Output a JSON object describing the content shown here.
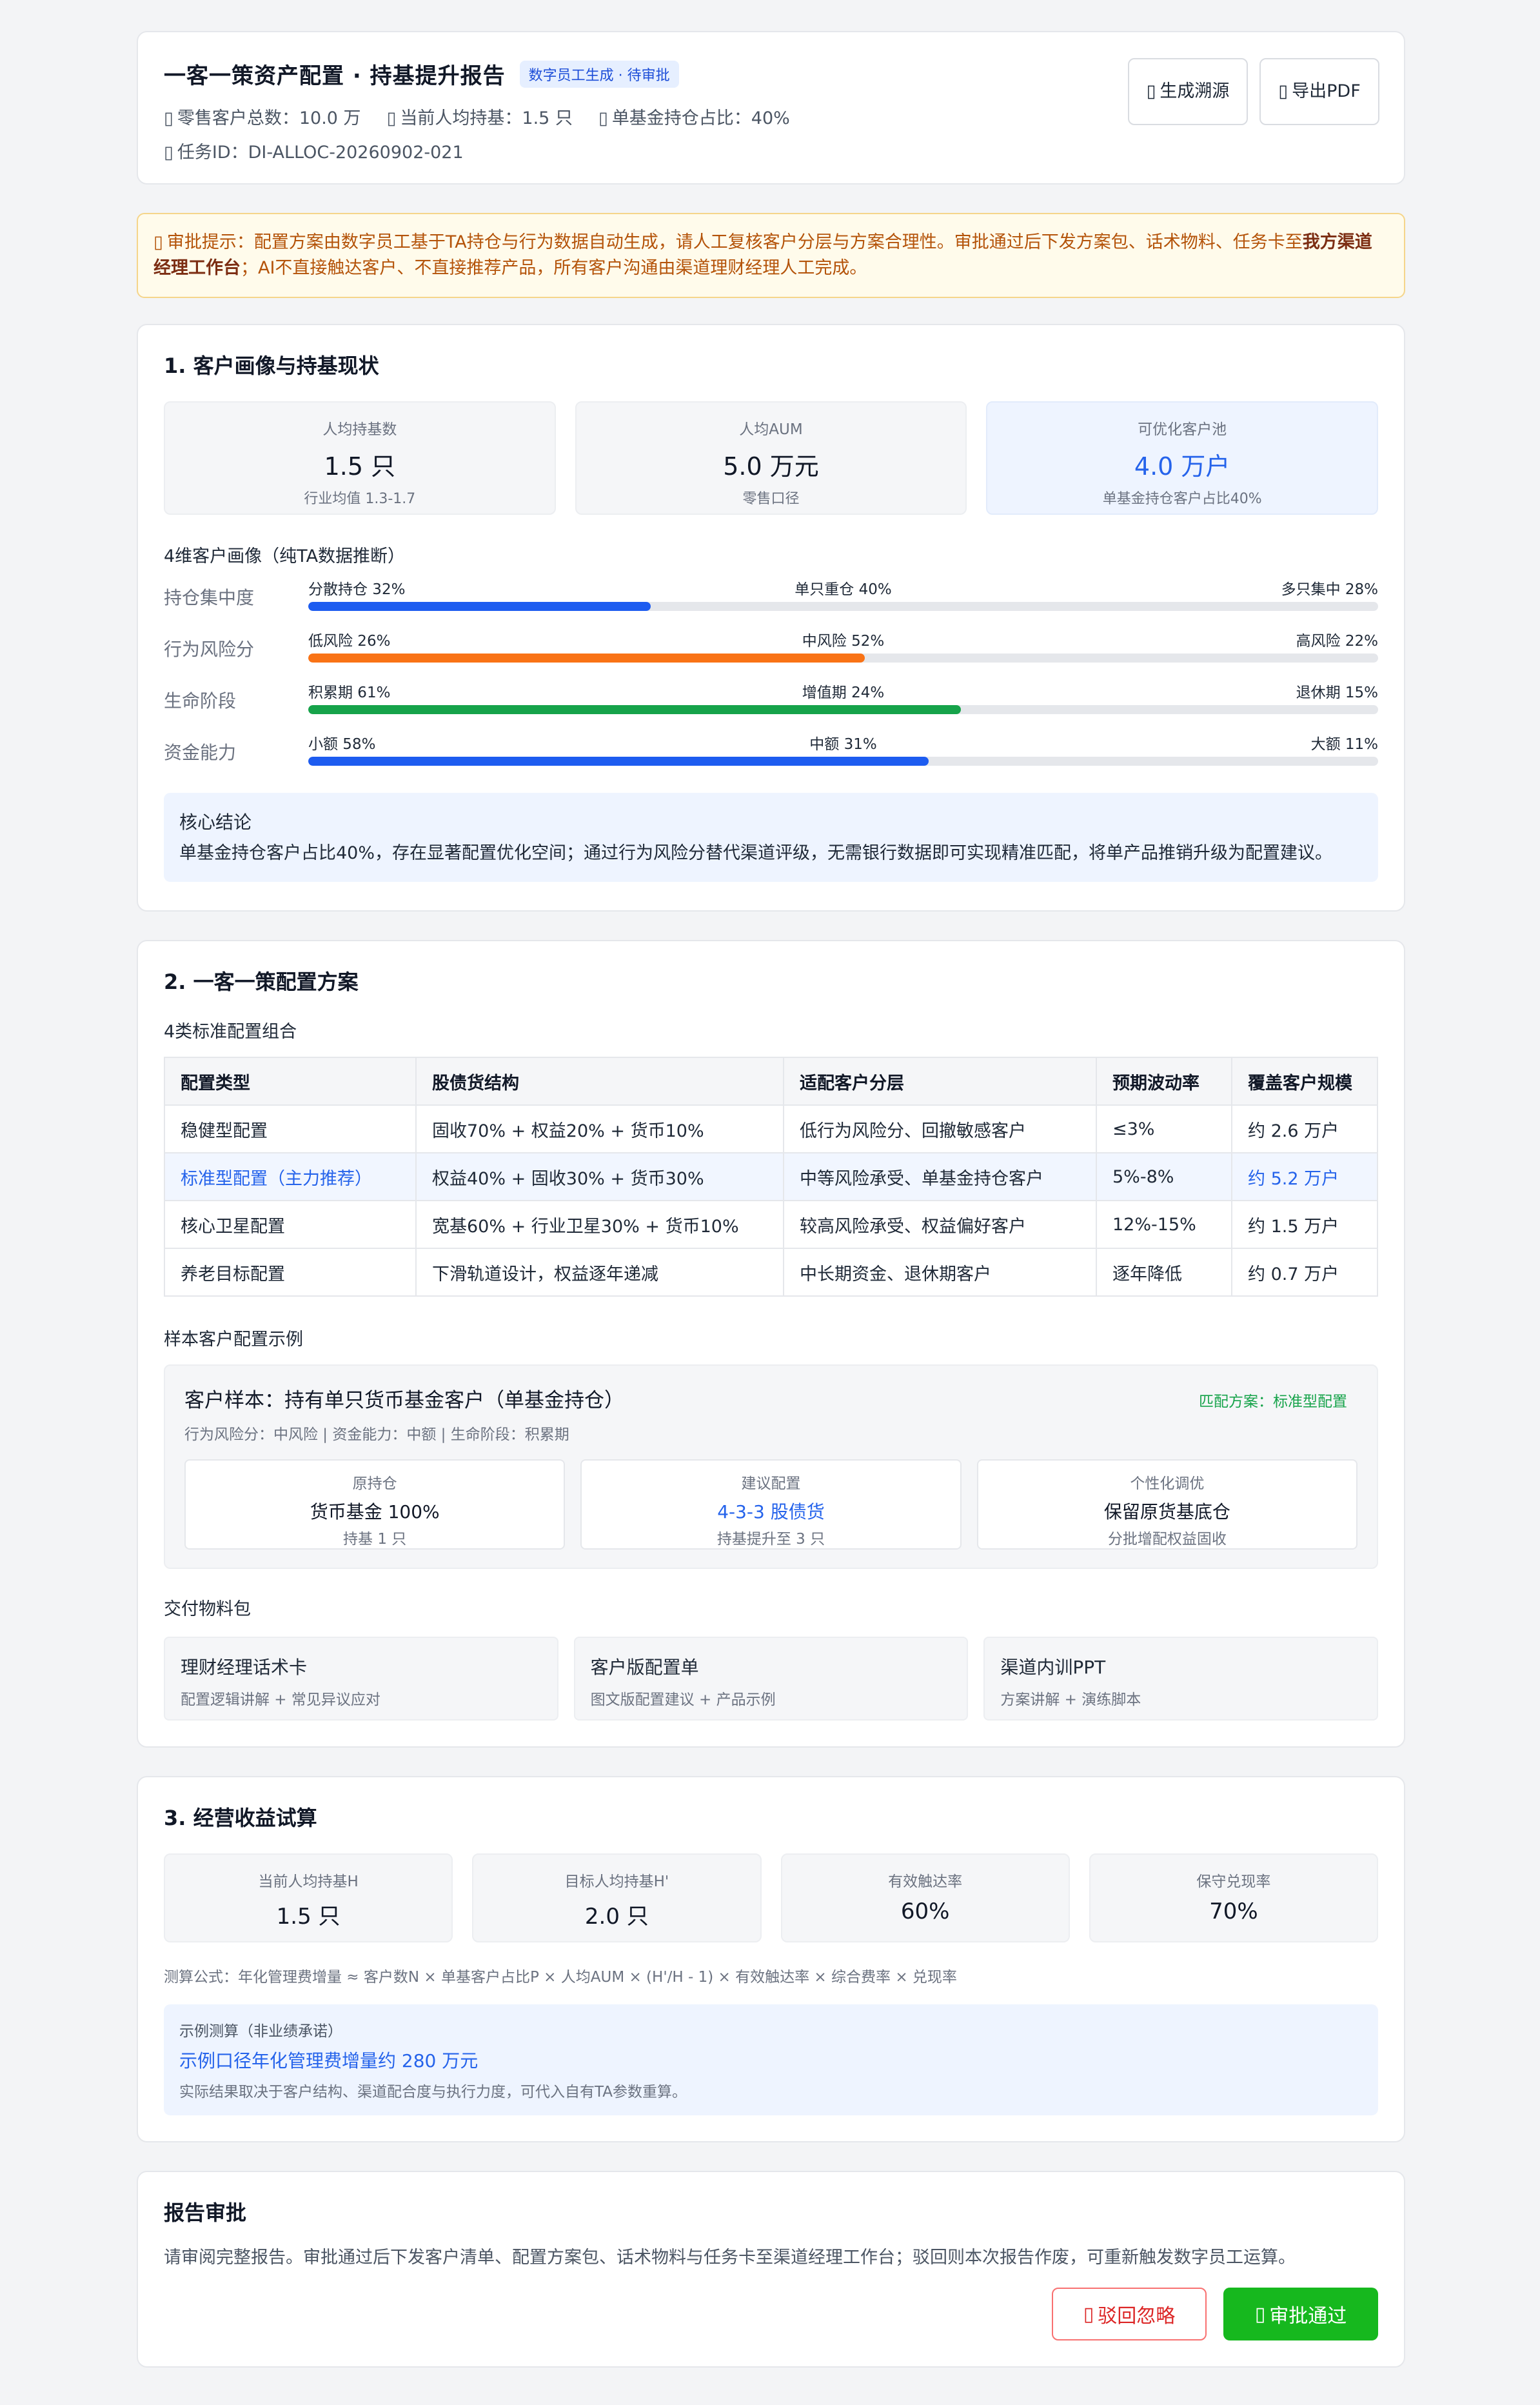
{
  "header": {
    "title": "一客一策资产配置 · 持基提升报告",
    "tag": "数字员工生成 · 待审批",
    "meta": [
      {
        "icon": "users-icon",
        "text": "零售客户总数：10.0 万"
      },
      {
        "icon": "chart-icon",
        "text": "当前人均持基：1.5 只"
      },
      {
        "icon": "pie-icon",
        "text": "单基金持仓占比：40%"
      }
    ],
    "task_id": "任务ID：DI-ALLOC-20260902-021",
    "trace_button": "生成溯源",
    "export_button": "导出PDF"
  },
  "notice": {
    "text_before": "审批提示：配置方案由数字员工基于TA持仓与行为数据自动生成，请人工复核客户分层与方案合理性。审批通过后下发方案包、话术物料、任务卡至",
    "bold": "我方渠道经理工作台",
    "text_after": "；AI不直接触达客户、不直接推荐产品，所有客户沟通由渠道理财经理人工完成。"
  },
  "section1": {
    "title": "1. 客户画像与持基现状",
    "stats": [
      {
        "label": "人均持基数",
        "value": "1.5 只",
        "note": "行业均值 1.3-1.7"
      },
      {
        "label": "人均AUM",
        "value": "5.0 万元",
        "note": "零售口径"
      },
      {
        "label": "可优化客户池",
        "value": "4.0 万户",
        "note": "单基金持仓客户占比40%"
      }
    ],
    "profile_title": "4维客户画像（纯TA数据推断）",
    "profiles": [
      {
        "label": "持仓集中度",
        "left": "分散持仓 32%",
        "mid": "单只重仓 40%",
        "right": "多只集中 28%",
        "fill": 32,
        "color": "#1d5cf0"
      },
      {
        "label": "行为风险分",
        "left": "低风险 26%",
        "mid": "中风险 52%",
        "right": "高风险 22%",
        "fill": 52,
        "color": "#f97316"
      },
      {
        "label": "生命阶段",
        "left": "积累期 61%",
        "mid": "增值期 24%",
        "right": "退休期 15%",
        "fill": 61,
        "color": "#16a34a"
      },
      {
        "label": "资金能力",
        "left": "小额 58%",
        "mid": "中额 31%",
        "right": "大额 11%",
        "fill": 58,
        "color": "#1d5cf0"
      }
    ],
    "conclusion_title": "核心结论",
    "conclusion_body": "单基金持仓客户占比40%，存在显著配置优化空间；通过行为风险分替代渠道评级，无需银行数据即可实现精准匹配，将单产品推销升级为配置建议。"
  },
  "section2": {
    "title": "2. 一客一策配置方案",
    "table_title": "4类标准配置组合",
    "columns": [
      "配置类型",
      "股债货结构",
      "适配客户分层",
      "预期波动率",
      "覆盖客户规模"
    ],
    "rows": [
      [
        "稳健型配置",
        "固收70% + 权益20% + 货币10%",
        "低行为风险分、回撤敏感客户",
        "≤3%",
        "约 2.6 万户"
      ],
      [
        "标准型配置（主力推荐）",
        "权益40% + 固收30% + 货币30%",
        "中等风险承受、单基金持仓客户",
        "5%-8%",
        "约 5.2 万户"
      ],
      [
        "核心卫星配置",
        "宽基60% + 行业卫星30% + 货币10%",
        "较高风险承受、权益偏好客户",
        "12%-15%",
        "约 1.5 万户"
      ],
      [
        "养老目标配置",
        "下滑轨道设计，权益逐年递减",
        "中长期资金、退休期客户",
        "逐年降低",
        "约 0.7 万户"
      ]
    ],
    "sample_title": "样本客户配置示例",
    "sample": {
      "title": "客户样本：持有单只货币基金客户（单基金持仓）",
      "meta": "行为风险分：中风险 | 资金能力：中额 | 生命阶段：积累期",
      "badge": "匹配方案：标准型配置",
      "boxes": [
        {
          "a": "原持仓",
          "b": "货币基金 100%",
          "c": "持基 1 只"
        },
        {
          "a": "建议配置",
          "b": "4-3-3 股债货",
          "c": "持基提升至 3 只"
        },
        {
          "a": "个性化调优",
          "b": "保留原货基底仓",
          "c": "分批增配权益固收"
        }
      ]
    },
    "materials_title": "交付物料包",
    "materials": [
      {
        "a": "理财经理话术卡",
        "b": "配置逻辑讲解 + 常见异议应对"
      },
      {
        "a": "客户版配置单",
        "b": "图文版配置建议 + 产品示例"
      },
      {
        "a": "渠道内训PPT",
        "b": "方案讲解 + 演练脚本"
      }
    ]
  },
  "section3": {
    "title": "3. 经营收益试算",
    "stats": [
      {
        "label": "当前人均持基H",
        "value": "1.5 只"
      },
      {
        "label": "目标人均持基H'",
        "value": "2.0 只"
      },
      {
        "label": "有效触达率",
        "value": "60%"
      },
      {
        "label": "保守兑现率",
        "value": "70%"
      }
    ],
    "formula": "测算公式：年化管理费增量 ≈ 客户数N × 单基客户占比P × 人均AUM × (H'/H - 1) × 有效触达率 × 综合费率 × 兑现率",
    "example_title": "示例测算（非业绩承诺）",
    "example_value": "示例口径年化管理费增量约 280 万元",
    "example_note": "实际结果取决于客户结构、渠道配合度与执行力度，可代入自有TA参数重算。"
  },
  "approval": {
    "title": "报告审批",
    "text": "请审阅完整报告。审批通过后下发客户清单、配置方案包、话术物料与任务卡至渠道经理工作台；驳回则本次报告作废，可重新触发数字员工运算。",
    "reject_button": "驳回忽略",
    "approve_button": "审批通过"
  }
}
